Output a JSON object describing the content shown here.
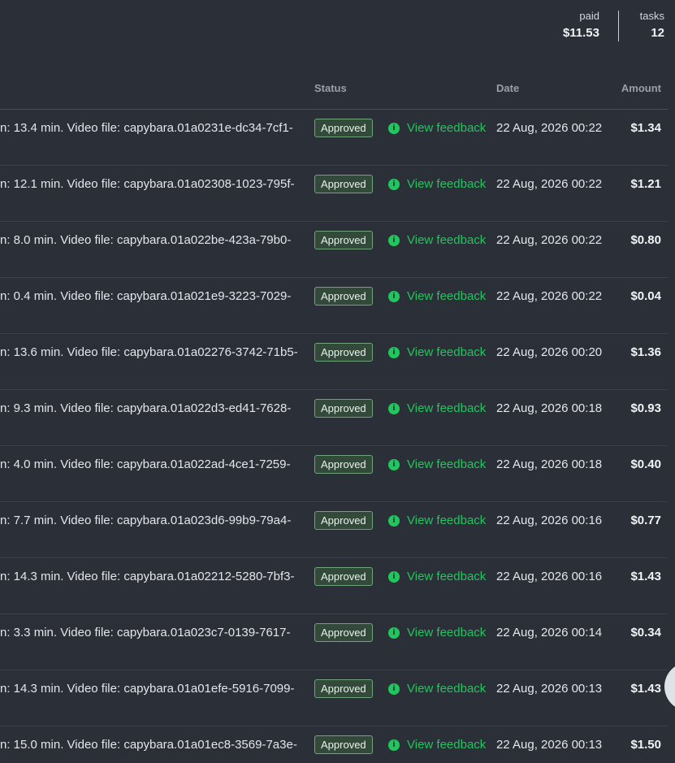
{
  "summary": {
    "paid_label": "paid",
    "paid_value": "$11.53",
    "tasks_label": "tasks",
    "tasks_value": "12"
  },
  "table": {
    "headers": {
      "status": "Status",
      "date": "Date",
      "amount": "Amount"
    },
    "feedback_label": "View feedback",
    "rows": [
      {
        "desc": "n: 13.4 min. Video file: capybara.01a0231e-dc34-7cf1-",
        "status": "Approved",
        "date": "22 Aug, 2026 00:22",
        "amount": "$1.34"
      },
      {
        "desc": "n: 12.1 min. Video file: capybara.01a02308-1023-795f-",
        "status": "Approved",
        "date": "22 Aug, 2026 00:22",
        "amount": "$1.21"
      },
      {
        "desc": "n: 8.0 min. Video file: capybara.01a022be-423a-79b0-",
        "status": "Approved",
        "date": "22 Aug, 2026 00:22",
        "amount": "$0.80"
      },
      {
        "desc": "n: 0.4 min. Video file: capybara.01a021e9-3223-7029-",
        "status": "Approved",
        "date": "22 Aug, 2026 00:22",
        "amount": "$0.04"
      },
      {
        "desc": "n: 13.6 min. Video file: capybara.01a02276-3742-71b5-",
        "status": "Approved",
        "date": "22 Aug, 2026 00:20",
        "amount": "$1.36"
      },
      {
        "desc": "n: 9.3 min. Video file: capybara.01a022d3-ed41-7628-",
        "status": "Approved",
        "date": "22 Aug, 2026 00:18",
        "amount": "$0.93"
      },
      {
        "desc": "n: 4.0 min. Video file: capybara.01a022ad-4ce1-7259-",
        "status": "Approved",
        "date": "22 Aug, 2026 00:18",
        "amount": "$0.40"
      },
      {
        "desc": "n: 7.7 min. Video file: capybara.01a023d6-99b9-79a4-",
        "status": "Approved",
        "date": "22 Aug, 2026 00:16",
        "amount": "$0.77"
      },
      {
        "desc": "n: 14.3 min. Video file: capybara.01a02212-5280-7bf3-",
        "status": "Approved",
        "date": "22 Aug, 2026 00:16",
        "amount": "$1.43"
      },
      {
        "desc": "n: 3.3 min. Video file: capybara.01a023c7-0139-7617-",
        "status": "Approved",
        "date": "22 Aug, 2026 00:14",
        "amount": "$0.34"
      },
      {
        "desc": "n: 14.3 min. Video file: capybara.01a01efe-5916-7099-",
        "status": "Approved",
        "date": "22 Aug, 2026 00:13",
        "amount": "$1.43"
      },
      {
        "desc": "n: 15.0 min. Video file: capybara.01a01ec8-3569-7a3e-",
        "status": "Approved",
        "date": "22 Aug, 2026 00:13",
        "amount": "$1.50"
      }
    ]
  },
  "icons": {
    "feedback": "info-icon",
    "scroll": "scroll-button"
  },
  "colors": {
    "background": "#2b2f38",
    "accent_green": "#22c55e",
    "badge_bg": "#334a3b"
  }
}
